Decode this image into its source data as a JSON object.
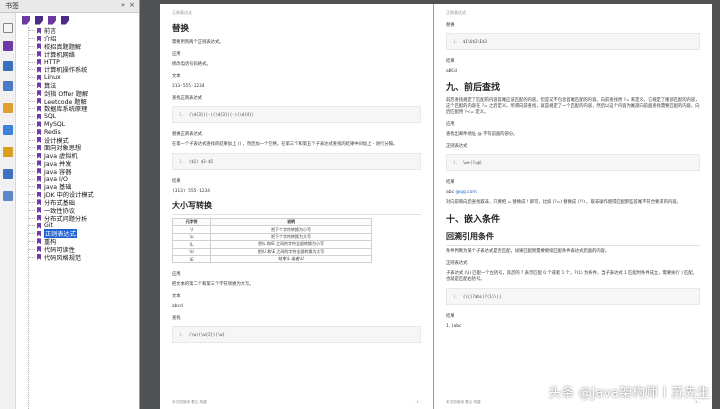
{
  "sidebar": {
    "title": "书签",
    "header_icons": [
      "»",
      "×"
    ],
    "toolbar_icons": [
      "bookmark-new-icon",
      "bookmark-expand-icon",
      "bookmark-find-icon",
      "bookmark-options-icon"
    ],
    "tree": [
      {
        "label": "前言"
      },
      {
        "label": "介绍"
      },
      {
        "label": "校招真题题解"
      },
      {
        "label": "计算机网络"
      },
      {
        "label": "HTTP"
      },
      {
        "label": "计算机操作系统"
      },
      {
        "label": "Linux"
      },
      {
        "label": "算法"
      },
      {
        "label": "剑指 Offer 题解"
      },
      {
        "label": "Leetcode 题解"
      },
      {
        "label": "数据库系统原理"
      },
      {
        "label": "SQL"
      },
      {
        "label": "MySQL"
      },
      {
        "label": "Redis"
      },
      {
        "label": "设计模式"
      },
      {
        "label": "面向对象思想"
      },
      {
        "label": "Java 虚拟机"
      },
      {
        "label": "Java 并发"
      },
      {
        "label": "Java 容器"
      },
      {
        "label": "Java I/O"
      },
      {
        "label": "Java 基础"
      },
      {
        "label": "JDK 中的设计模式"
      },
      {
        "label": "分布式基础"
      },
      {
        "label": "一致性协议"
      },
      {
        "label": "分布式问题分析"
      },
      {
        "label": "Git"
      },
      {
        "label": "正则表达式",
        "selected": true
      },
      {
        "label": "重构"
      },
      {
        "label": "代码可读性"
      },
      {
        "label": "代码风格规范"
      }
    ]
  },
  "page1": {
    "running_header": "正则表达式",
    "section_replace": "替换",
    "replace_intro": "需要用到两个正则表达式。",
    "app_label": "应用",
    "app_text": "修改电话号码格式。",
    "text_label": "文本",
    "text_value": "313-555-1234",
    "find_regex_label": "查找正则表达式",
    "find_regex": "(\\d{3})(-)(\\d{3})(-)(\\d{4})",
    "replace_regex_label": "替换正则表达式",
    "replace_desc": "在第一个子表达式查找的结果加上 () ，然后加一个空格，在第三个和第五个子表达式查找的结果中间加上 - 进行分隔。",
    "replace_regex": "($1) $3-$5",
    "result_label": "结果",
    "result_value": "(313) 555-1234",
    "section_case": "大小写转换",
    "table": {
      "headers": [
        "元字符",
        "说明"
      ],
      "rows": [
        [
          "\\l",
          "把下个字符转换为小写"
        ],
        [
          "\\u",
          "把下个字符转换为大写"
        ],
        [
          "\\L",
          "把\\L 和\\E 之间的字符全部转换为小写"
        ],
        [
          "\\U",
          "把\\U 和\\E 之间的字符全部转换为大写"
        ],
        [
          "\\E",
          "结束\\L 或者\\U"
        ]
      ]
    },
    "case_app_label": "应用",
    "case_app_text": "把文本的第二个和第三个字符转换为大写。",
    "case_text_label": "文本",
    "case_text_value": "abcd",
    "case_find_label": "查找",
    "case_find_regex": "(\\w)(\\w{2})(\\w)",
    "footer_left": "本文档使用 看云 构建",
    "footer_link": "",
    "footer_right": "- 1 -"
  },
  "page2": {
    "running_header": "正则表达式",
    "replace_label": "替换",
    "replace_code": "$1\\U$2\\E$3",
    "result_label": "结果",
    "result_value": "aBCd",
    "section_lookaround": "九、前后查找",
    "lookaround_desc": "前后查找规定了匹配的内容首尾应该匹配的内容，但是又不包含首尾匹配的内容。向前查找用 ?= 来定义，它规定了尾部匹配的内容，这个匹配的内容在 ?= 之后定义。所谓向前查找，就是规定了一个匹配的内容，然后以这个内容为尾部向前面查找需要匹配的内容。向后匹配用 ?<= 定义。",
    "look_app_label": "应用",
    "look_app_text": "查找出邮件地址 @ 字符前面的部分。",
    "look_regex_label": "正则表达式",
    "look_regex": "\\w+(?=@)",
    "look_result_label": "结果",
    "look_result_prefix": "abc ",
    "look_result_link": "@qq.com",
    "look_note": "对向前和向后查找取非，只要把 = 替换成 ! 即可，比如 (?=) 替换成 (?!) 。取非操作使得匹配那些首尾不符合要求的内容。",
    "section_embed": "十、嵌入条件",
    "sub_backref": "回溯引用条件",
    "backref_desc": "条件判断为某个子表达式是否匹配，如果匹配则需要继续匹配条件表达式后面的内容。",
    "backref_regex_label": "正则表达式",
    "backref_desc2": "子表达式 (\\() 匹配一个左括号，其后的 ? 表示匹配 0 个或者 1 个。?(1) 为条件，当子表达式 1 匹配时条件成立，需要执行 ) 匹配，也就是匹配右括号。",
    "backref_regex": "(\\()?abc(?(1)\\))",
    "backref_result_label": "结果",
    "list_item": "1. (abc",
    "footer_left": "本文档使用 看云 构建",
    "footer_right": "- 2 -"
  },
  "watermark": "头条 @Java架构师丨苏先生"
}
